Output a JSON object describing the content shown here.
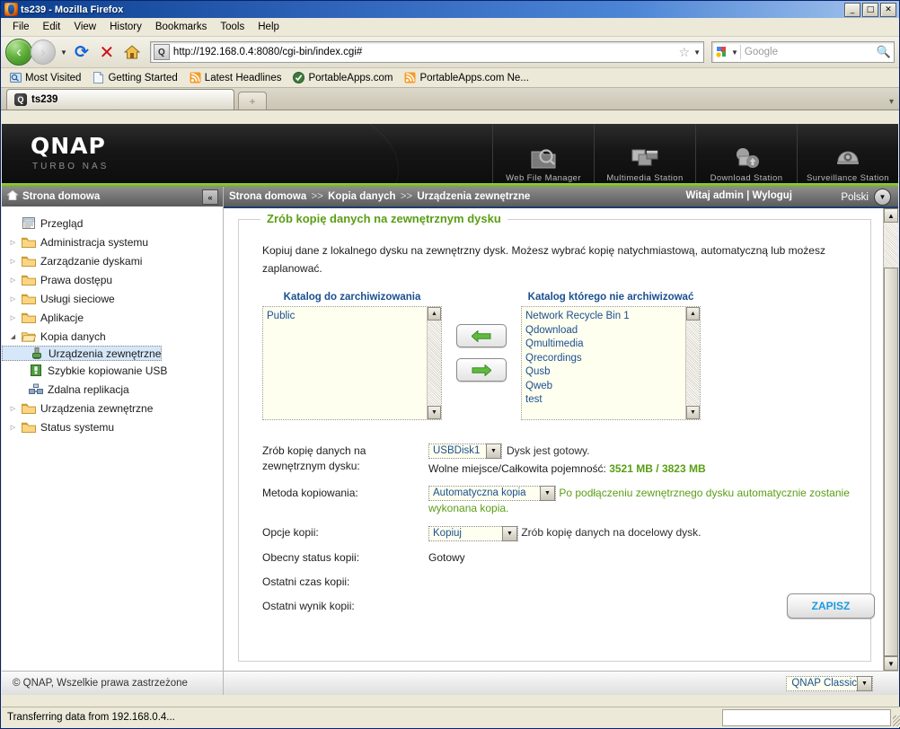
{
  "browser": {
    "title": "ts239 - Mozilla Firefox",
    "window_buttons": {
      "minimize": "_",
      "maximize": "□",
      "close": "✕"
    },
    "menus": [
      "File",
      "Edit",
      "View",
      "History",
      "Bookmarks",
      "Tools",
      "Help"
    ],
    "url": "http://192.168.0.4:8080/cgi-bin/index.cgi#",
    "search_placeholder": "Google",
    "bookmarks": [
      "Most Visited",
      "Getting Started",
      "Latest Headlines",
      "PortableApps.com",
      "PortableApps.com Ne..."
    ],
    "tab_label": "ts239",
    "status_text": "Transferring data from 192.168.0.4..."
  },
  "banner": {
    "logo": "QNAP",
    "tagline": "TURBO NAS",
    "nav": [
      "Web File Manager",
      "Multimedia Station",
      "Download Station",
      "Surveillance Station"
    ]
  },
  "sidebar": {
    "header": "Strona domowa",
    "collapse_label": "«",
    "items": [
      {
        "label": "Przegląd",
        "type": "leaf",
        "icon": "document-icon",
        "expandable": false,
        "selected": false
      },
      {
        "label": "Administracja systemu",
        "type": "folder",
        "icon": "folder-icon",
        "expandable": true,
        "selected": false
      },
      {
        "label": "Zarządzanie dyskami",
        "type": "folder",
        "icon": "folder-icon",
        "expandable": true,
        "selected": false
      },
      {
        "label": "Prawa dostępu",
        "type": "folder",
        "icon": "folder-icon",
        "expandable": true,
        "selected": false
      },
      {
        "label": "Usługi sieciowe",
        "type": "folder",
        "icon": "folder-icon",
        "expandable": true,
        "selected": false
      },
      {
        "label": "Aplikacje",
        "type": "folder",
        "icon": "folder-icon",
        "expandable": true,
        "selected": false
      },
      {
        "label": "Kopia danych",
        "type": "folder-open",
        "icon": "folder-open-icon",
        "expandable": true,
        "expanded": true,
        "selected": false
      },
      {
        "label": "Urządzenia zewnętrzne",
        "type": "child",
        "icon": "usb-device-icon",
        "selected": true
      },
      {
        "label": "Szybkie kopiowanie USB",
        "type": "child",
        "icon": "usb-green-icon",
        "selected": false
      },
      {
        "label": "Zdalna replikacja",
        "type": "child",
        "icon": "replication-icon",
        "selected": false
      },
      {
        "label": "Urządzenia zewnętrzne",
        "type": "folder",
        "icon": "folder-icon",
        "expandable": true,
        "selected": false
      },
      {
        "label": "Status systemu",
        "type": "folder",
        "icon": "folder-icon",
        "expandable": true,
        "selected": false
      }
    ],
    "footer": "© QNAP, Wszelkie prawa zastrzeżone"
  },
  "topbar": {
    "breadcrumb": [
      "Strona domowa",
      "Kopia danych",
      "Urządzenia zewnętrzne"
    ],
    "separator": ">>",
    "welcome": "Witaj admin | Wyloguj",
    "language": "Polski"
  },
  "panel": {
    "legend": "Zrób kopię danych na zewnętrznym dysku",
    "intro": "Kopiuj dane z lokalnego dysku na zewnętrzny dysk. Możesz wybrać kopię natychmiastową, automatyczną lub możesz zaplanować.",
    "include_title": "Katalog do zarchiwizowania",
    "include_items": [
      "Public"
    ],
    "exclude_title": "Katalog którego nie archiwizować",
    "exclude_items": [
      "Network Recycle Bin 1",
      "Qdownload",
      "Qmultimedia",
      "Qrecordings",
      "Qusb",
      "Qweb",
      "test"
    ],
    "move_left_label": "←",
    "move_right_label": "→"
  },
  "form": {
    "disk_label": "Zrób kopię danych na zewnętrznym dysku:",
    "disk_value": "USBDisk1",
    "disk_status": "Dysk jest gotowy.",
    "capacity_label": "Wolne miejsce/Całkowita pojemność:",
    "capacity_free": "3521 MB",
    "capacity_sep": "/",
    "capacity_total": "3823 MB",
    "method_label": "Metoda kopiowania:",
    "method_value": "Automatyczna kopia",
    "method_hint": "Po podłączeniu zewnętrznego dysku automatycznie zostanie wykonana kopia.",
    "options_label": "Opcje kopii:",
    "options_value": "Kopiuj",
    "options_hint": "Zrób kopię danych na docelowy dysk.",
    "status_label": "Obecny status kopii:",
    "status_value": "Gotowy",
    "lasttime_label": "Ostatni czas kopii:",
    "lasttime_value": "",
    "lastresult_label": "Ostatni wynik kopii:",
    "lastresult_value": "",
    "save_button": "ZAPISZ"
  },
  "theme": {
    "selected": "QNAP Classic"
  },
  "colors": {
    "accent_green": "#8dc63f",
    "heading_green": "#5a9e15",
    "link_blue": "#1a4f8f",
    "save_blue": "#1c9ae0",
    "titlebar_blue": "#2d62b8"
  }
}
